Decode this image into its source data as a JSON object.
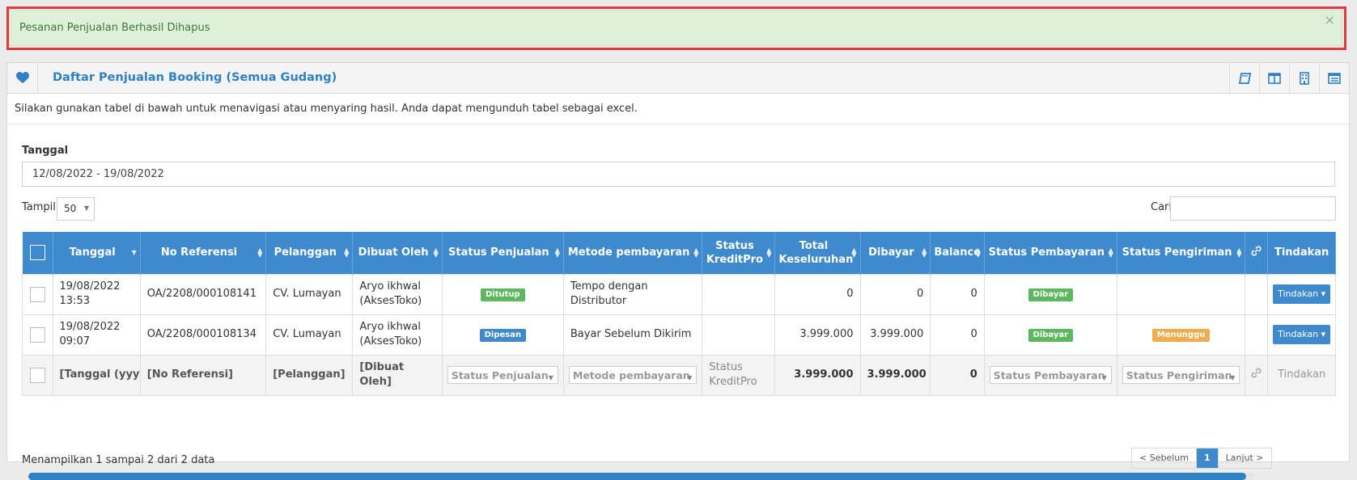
{
  "alert": {
    "message": "Pesanan Penjualan Berhasil Dihapus",
    "close": "×"
  },
  "panel": {
    "title": "Daftar Penjualan Booking (Semua Gudang)",
    "intro": "Silakan gunakan tabel di bawah untuk menavigasi atau menyaring hasil. Anda dapat mengunduh tabel sebagai excel.",
    "header_icons": [
      "book-icon",
      "columns-icon",
      "building-icon",
      "list-icon"
    ]
  },
  "filter_date": {
    "label": "Tanggal",
    "value": "12/08/2022 - 19/08/2022"
  },
  "length": {
    "label": "Tampil",
    "value": "50"
  },
  "search": {
    "label": "Cari",
    "value": ""
  },
  "table": {
    "columns": [
      "Tanggal",
      "No Referensi",
      "Pelanggan",
      "Dibuat Oleh",
      "Status Penjualan",
      "Metode pembayaran",
      "Status KreditPro",
      "Total Keseluruhan",
      "Dibayar",
      "Balance",
      "Status Pembayaran",
      "Status Pengiriman",
      "",
      "Tindakan"
    ],
    "rows": [
      {
        "tanggal": "19/08/2022 13:53",
        "ref": "OA/2208/000108141",
        "pelanggan": "CV. Lumayan",
        "dibuat": "Aryo ikhwal (AksesToko)",
        "status_penjualan": "Ditutup",
        "metode": "Tempo dengan Distributor",
        "kreditpro": "",
        "total": "0",
        "dibayar": "0",
        "balance": "0",
        "status_pembayaran": "Dibayar",
        "status_pengiriman": "",
        "action": "Tindakan"
      },
      {
        "tanggal": "19/08/2022 09:07",
        "ref": "OA/2208/000108134",
        "pelanggan": "CV. Lumayan",
        "dibuat": "Aryo ikhwal (AksesToko)",
        "status_penjualan": "Dipesan",
        "metode": "Bayar Sebelum Dikirim",
        "kreditpro": "",
        "total": "3.999.000",
        "dibayar": "3.999.000",
        "balance": "0",
        "status_pembayaran": "Dibayar",
        "status_pengiriman": "Menunggu",
        "action": "Tindakan"
      }
    ],
    "footer": {
      "tanggal": "[Tanggal (yyyy-",
      "ref": "[No Referensi]",
      "pelanggan": "[Pelanggan]",
      "dibuat": "[Dibuat Oleh]",
      "status_penjualan": "Status Penjualan",
      "metode": "Metode pembayaran",
      "kreditpro": "Status KreditPro",
      "total": "3.999.000",
      "dibayar": "3.999.000",
      "balance": "0",
      "status_pembayaran": "Status Pembayaran",
      "status_pengiriman": "Status Pengiriman",
      "action": "Tindakan"
    }
  },
  "info": "Menampilkan 1 sampai 2 dari 2 data",
  "pager": {
    "prev": "< Sebelum",
    "current": "1",
    "next": "Lanjut >"
  },
  "scroll_fraction": 0.993,
  "colors": {
    "accent": "#3f8acd",
    "success": "#5cb85c",
    "warning": "#f0ad4e",
    "alert_bg": "#dff0d8",
    "highlight": "#e0393e"
  }
}
